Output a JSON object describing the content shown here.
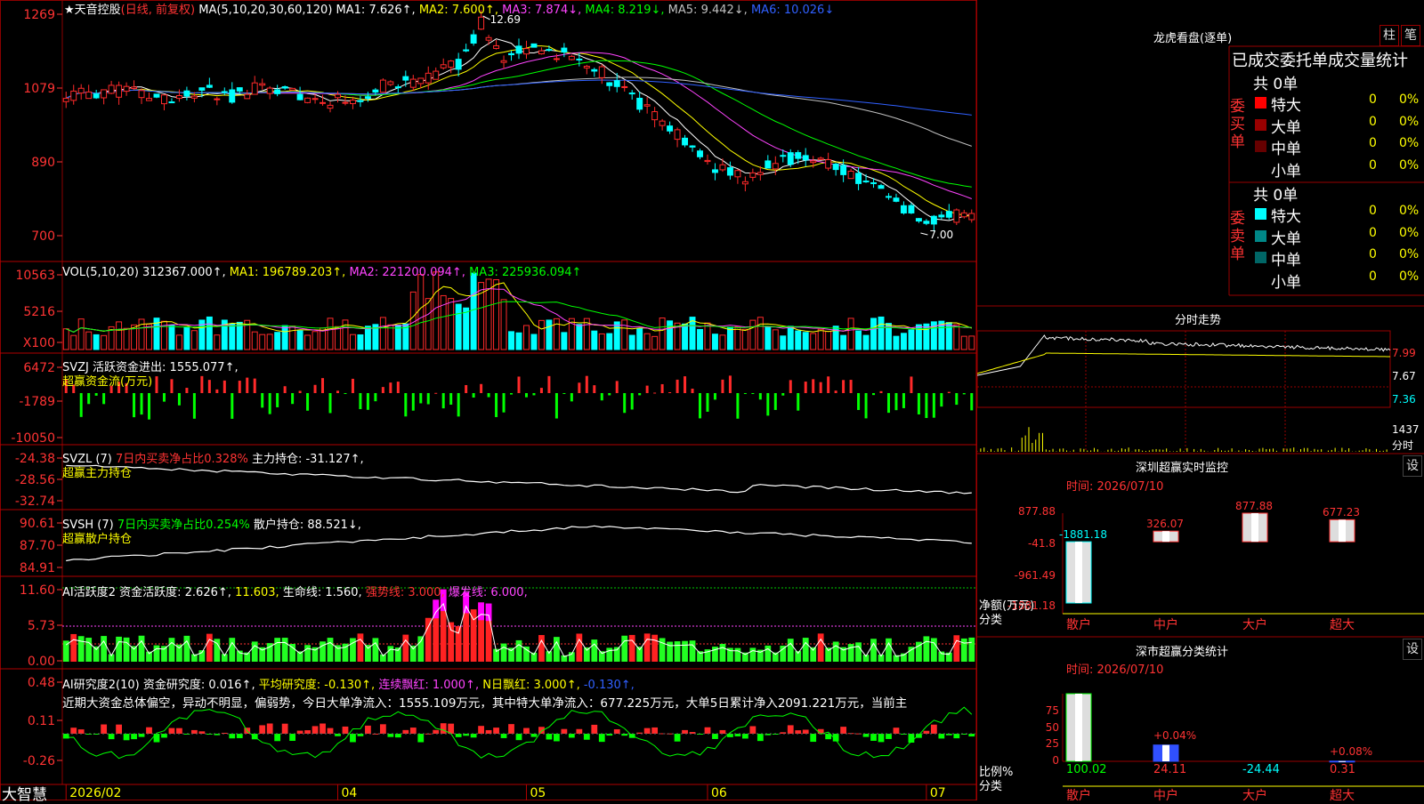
{
  "stock": {
    "name": "天音控股",
    "mode": "(日线, 前复权)",
    "star": "★"
  },
  "brand": "大智慧",
  "date_axis": [
    {
      "label": "2026/02",
      "idx": 0
    },
    {
      "label": "04",
      "idx": 36
    },
    {
      "label": "05",
      "idx": 61
    },
    {
      "label": "06",
      "idx": 85
    },
    {
      "label": "07",
      "idx": 114
    }
  ],
  "colors": {
    "up": "#ff2a2a",
    "down": "#00ffff",
    "grid": "#8b0000",
    "axis": "#ff3333",
    "ma1": "#ffffff",
    "ma2": "#ffff00",
    "ma3": "#ff44ff",
    "ma4": "#00ff00",
    "ma5": "#c0c0c0",
    "ma6": "#3060ff"
  },
  "price_panel": {
    "ticks": [
      "1269",
      "1079",
      "890",
      "700"
    ],
    "header": {
      "ma_params": "MA(5,10,20,30,60,120)",
      "ma1": "MA1: 7.626↑,",
      "ma2": "MA2: 7.600↑,",
      "ma3": "MA3: 7.874↓,",
      "ma4": "MA4: 8.219↓,",
      "ma5": "MA5: 9.442↓,",
      "ma6": "MA6: 10.026↓"
    },
    "high_label": "12.69",
    "low_label": "7.00"
  },
  "vol_panel": {
    "ticks": [
      "10563",
      "5216",
      "X100"
    ],
    "header": {
      "params": "VOL(5,10,20)",
      "val": "312367.000↑,",
      "ma1": "MA1: 196789.203↑,",
      "ma2": "MA2: 221200.094↑,",
      "ma3": "MA3: 225936.094↑"
    }
  },
  "svzj_panel": {
    "ticks": [
      "6472",
      "-1789",
      "-10050"
    ],
    "header": {
      "name": "SVZJ",
      "text": "活跃资金进出: 1555.077↑,"
    },
    "subtitle": "超赢资金流(万元)"
  },
  "svzl_panel": {
    "ticks": [
      "-24.38",
      "-28.56",
      "-32.74"
    ],
    "header": {
      "name": "SVZL (7)",
      "ratio": "7日内买卖净占比0.328%",
      "text": "主力持仓: -31.127↑,"
    },
    "subtitle": "超赢主力持仓"
  },
  "svsh_panel": {
    "ticks": [
      "90.61",
      "87.70",
      "84.91"
    ],
    "header": {
      "name": "SVSH (7)",
      "ratio": "7日内买卖净占比0.254%",
      "text": "散户持仓: 88.521↓,"
    },
    "subtitle": "超赢散户持仓"
  },
  "ai_active_panel": {
    "ticks": [
      "11.60",
      "5.73",
      "0.00"
    ],
    "header": {
      "name": "AI活跃度2",
      "text": "资金活跃度: 2.626↑,",
      "v2": "11.603,",
      "life": "生命线: 1.560,",
      "strong": "强势线: 3.000,",
      "burst": "爆发线: 6.000,"
    }
  },
  "ai_research_panel": {
    "ticks": [
      "0.48",
      "0.11",
      "-0.26"
    ],
    "header": {
      "name": "AI研究度2(10)",
      "text": "资金研究度: 0.016↑,",
      "avg": "平均研究度: -0.130↑,",
      "red": "连续飘红: 1.000↑,",
      "nred": "N日飘红: 3.000↑,",
      "last": "-0.130↑,"
    },
    "commentary": "近期大资金总体偏空，异动不明显，偏弱势，今日大单净流入：1555.109万元，其中特大单净流入：677.225万元，大单5日累计净入2091.221万元，当前主"
  },
  "side": {
    "lhb": {
      "title": "龙虎看盘(逐单)",
      "btn1": "柱",
      "btn2": "笔",
      "headline": "已成交委托单成交量统计",
      "buy": {
        "total": "共 0单",
        "label": "委买单",
        "rows": [
          {
            "name": "特大",
            "count": "0",
            "pct": "0%",
            "color": "#ff0000"
          },
          {
            "name": "大单",
            "count": "0",
            "pct": "0%",
            "color": "#990000"
          },
          {
            "name": "中单",
            "count": "0",
            "pct": "0%",
            "color": "#660000"
          },
          {
            "name": "小单",
            "count": "0",
            "pct": "0%",
            "color": "#000000"
          }
        ]
      },
      "sell": {
        "total": "共 0单",
        "label": "委卖单",
        "rows": [
          {
            "name": "特大",
            "count": "0",
            "pct": "0%",
            "color": "#00ffff"
          },
          {
            "name": "大单",
            "count": "0",
            "pct": "0%",
            "color": "#008888"
          },
          {
            "name": "中单",
            "count": "0",
            "pct": "0%",
            "color": "#006666"
          },
          {
            "name": "小单",
            "count": "0",
            "pct": "0%",
            "color": "#000000"
          }
        ]
      }
    },
    "intraday": {
      "title": "分时走势",
      "ticks": [
        "7.99",
        "7.67",
        "7.36"
      ],
      "vol_tick": "1437",
      "vol_label": "分时"
    },
    "sz_monitor": {
      "title": "深圳超赢实时监控",
      "btn": "设",
      "time": "时间: 2026/07/10",
      "ticks": [
        "877.88",
        "-41.8",
        "-961.49",
        "-1881.18"
      ],
      "ylabel": "净额(万元)",
      "xlabel": "分类",
      "chart_data": {
        "type": "bar",
        "categories": [
          "散户",
          "中户",
          "大户",
          "超大"
        ],
        "values": [
          -1881.18,
          326.07,
          877.88,
          677.23
        ],
        "labels": [
          "-1881.18",
          "326.07",
          "877.88",
          "677.23"
        ],
        "ylim": [
          -1881.18,
          877.88
        ]
      }
    },
    "sz_class": {
      "title": "深市超赢分类统计",
      "btn": "设",
      "time": "时间: 2026/07/10",
      "ticks": [
        "75",
        "50",
        "25",
        "0"
      ],
      "ylabel": "比例%",
      "xlabel": "分类",
      "chart_data": {
        "type": "bar",
        "categories": [
          "散户",
          "中户",
          "大户",
          "超大"
        ],
        "values": [
          100.02,
          24.11,
          -24.44,
          0.31
        ],
        "labels": [
          "100.02",
          "24.11",
          "-24.44",
          "0.31"
        ],
        "pct_labels": [
          "",
          "+0.04%",
          "",
          "+0.08%"
        ],
        "ylim": [
          0,
          100
        ]
      }
    }
  }
}
